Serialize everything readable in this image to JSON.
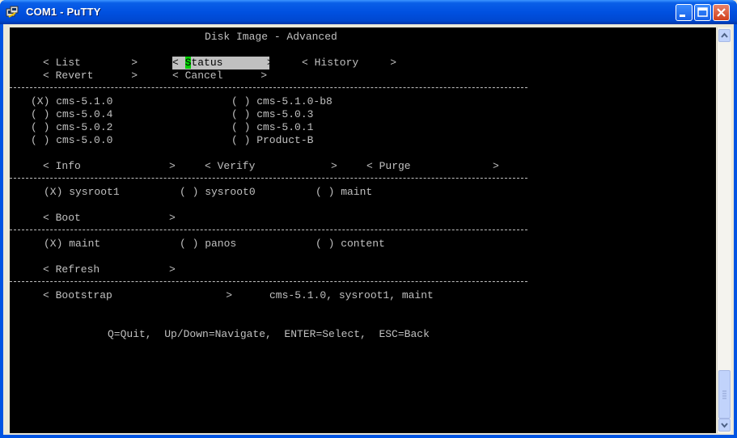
{
  "window": {
    "title": "COM1 - PuTTY",
    "icon": "putty-icon",
    "controls": [
      "minimize-icon",
      "maximize-icon",
      "close-icon"
    ]
  },
  "terminal": {
    "header": "Disk Image - Advanced",
    "menu1": {
      "list": "< List        >",
      "status_open": "< ",
      "status_cursor": "S",
      "status_rest": "tatus       >",
      "history": "< History     >",
      "revert": "< Revert      >",
      "cancel": "< Cancel      >"
    },
    "images": [
      "(X) cms-5.1.0",
      "( ) cms-5.1.0-b8",
      "( ) cms-5.0.4",
      "( ) cms-5.0.3",
      "( ) cms-5.0.2",
      "( ) cms-5.0.1",
      "( ) cms-5.0.0",
      "( ) Product-B"
    ],
    "image_actions": {
      "info": "< Info              >",
      "verify": "< Verify            >",
      "purge": "< Purge             >"
    },
    "sysroots": [
      "(X) sysroot1",
      "( ) sysroot0",
      "( ) maint"
    ],
    "boot": "< Boot              >",
    "targets": [
      "(X) maint",
      "( ) panos",
      "( ) content"
    ],
    "refresh": "< Refresh           >",
    "bootstrap": "< Bootstrap                  >",
    "bootstrap_value": "cms-5.1.0, sysroot1, maint",
    "help": "Q=Quit,  Up/Down=Navigate,  ENTER=Select,  ESC=Back"
  }
}
